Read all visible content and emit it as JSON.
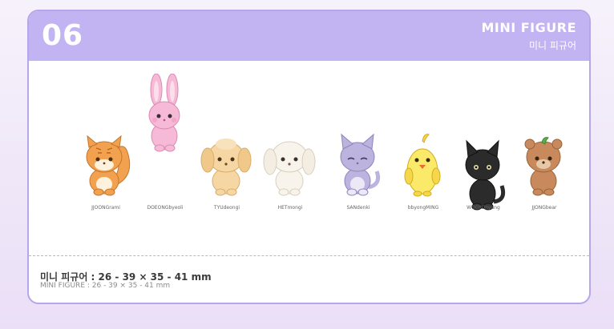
{
  "header": {
    "number": "06",
    "title_en": "MINI FIGURE",
    "title_ko": "미니 피규어"
  },
  "figures": [
    {
      "name": "JJOONGrami",
      "icon": "squirrel-figure-icon",
      "color": "#f2a24e"
    },
    {
      "name": "DOEONGbyeoli",
      "icon": "rabbit-figure-icon",
      "color": "#f6b9d6"
    },
    {
      "name": "TYUdeongi",
      "icon": "puppy-figure-icon",
      "color": "#f6d7a4"
    },
    {
      "name": "HETmongi",
      "icon": "white-puppy-figure-icon",
      "color": "#f8f4ec"
    },
    {
      "name": "SANdenki",
      "icon": "cat-figure-icon",
      "color": "#bcb3de"
    },
    {
      "name": "bbyongMING",
      "icon": "chick-figure-icon",
      "color": "#fbe96a"
    },
    {
      "name": "WOOYOnyang",
      "icon": "black-cat-figure-icon",
      "color": "#2b2b2b"
    },
    {
      "name": "JJONGbear",
      "icon": "bear-figure-icon",
      "color": "#c88a5c"
    }
  ],
  "spec": {
    "ko": "미니 피규어 : 26 - 39 × 35 - 41 mm",
    "en": "MINI FIGURE : 26 - 39 × 35 - 41 mm"
  },
  "colors": {
    "header_bg": "#c2b3f2",
    "card_border": "#b7a6ea"
  }
}
